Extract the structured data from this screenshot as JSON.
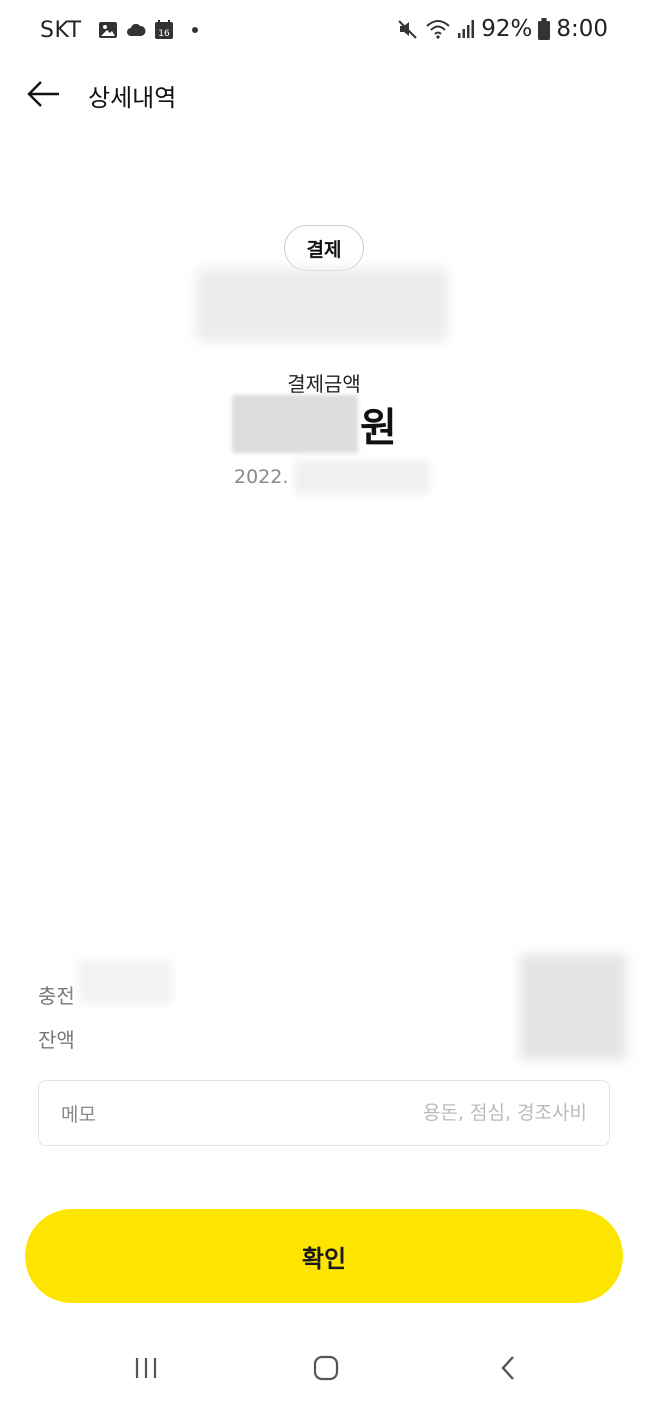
{
  "status_bar": {
    "carrier": "SKT",
    "calendar_day": "16",
    "battery": "92%",
    "time": "8:00",
    "icons": [
      "image-icon",
      "cloud-icon",
      "calendar-icon",
      "notification-dot",
      "mute-icon",
      "wifi-icon",
      "signal-icon",
      "battery-icon"
    ]
  },
  "header": {
    "title": "상세내역",
    "back_icon": "arrow-left-icon"
  },
  "summary": {
    "type_badge": "결제",
    "amount_label": "결제금액",
    "amount_unit": "원",
    "date_prefix": "2022."
  },
  "details": {
    "charge_label": "충전",
    "balance_label": "잔액"
  },
  "memo": {
    "label": "메모",
    "placeholder": "용돈, 점심, 경조사비",
    "value": ""
  },
  "confirm_label": "확인",
  "nav_bar": {
    "icons": [
      "recent-apps-icon",
      "home-icon",
      "back-icon"
    ]
  },
  "colors": {
    "accent": "#fee500",
    "text": "#111111",
    "muted": "#8a8a8a",
    "border": "#e3e3e3"
  }
}
